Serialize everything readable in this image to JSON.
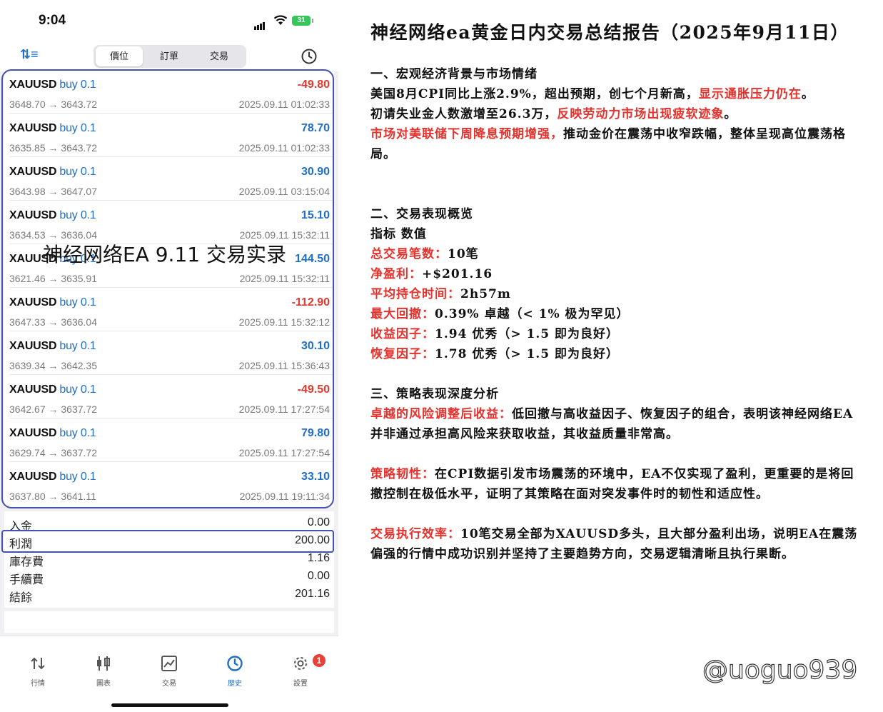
{
  "status_bar": {
    "time": "9:04",
    "battery": "31"
  },
  "tabs": [
    "價位",
    "訂單",
    "交易"
  ],
  "trades": [
    {
      "symbol": "XAUUSD",
      "side": "buy 0.1",
      "prices": "3648.70 → 3643.72",
      "profit": "-49.80",
      "date": "2025.09.11 01:02:33"
    },
    {
      "symbol": "XAUUSD",
      "side": "buy 0.1",
      "prices": "3635.85 → 3643.72",
      "profit": "78.70",
      "date": "2025.09.11 01:02:33"
    },
    {
      "symbol": "XAUUSD",
      "side": "buy 0.1",
      "prices": "3643.98 → 3647.07",
      "profit": "30.90",
      "date": "2025.09.11 03:15:04"
    },
    {
      "symbol": "XAUUSD",
      "side": "buy 0.1",
      "prices": "3634.53 → 3636.04",
      "profit": "15.10",
      "date": "2025.09.11 15:32:11"
    },
    {
      "symbol": "XAUUSD",
      "side": "buy 0.1",
      "prices": "3621.46 → 3635.91",
      "profit": "144.50",
      "date": "2025.09.11 15:32:11"
    },
    {
      "symbol": "XAUUSD",
      "side": "buy 0.1",
      "prices": "3647.33 → 3636.04",
      "profit": "-112.90",
      "date": "2025.09.11 15:32:12"
    },
    {
      "symbol": "XAUUSD",
      "side": "buy 0.1",
      "prices": "3639.34 → 3642.35",
      "profit": "30.10",
      "date": "2025.09.11 15:36:43"
    },
    {
      "symbol": "XAUUSD",
      "side": "buy 0.1",
      "prices": "3642.67 → 3637.72",
      "profit": "-49.50",
      "date": "2025.09.11 17:27:54"
    },
    {
      "symbol": "XAUUSD",
      "side": "buy 0.1",
      "prices": "3629.74 → 3637.72",
      "profit": "79.80",
      "date": "2025.09.11 17:27:54"
    },
    {
      "symbol": "XAUUSD",
      "side": "buy 0.1",
      "prices": "3637.80 → 3641.11",
      "profit": "33.10",
      "date": "2025.09.11 19:11:34"
    }
  ],
  "overlay_text": "神经网络EA 9.11 交易实录",
  "summary": [
    {
      "label": "入金",
      "value": "0.00"
    },
    {
      "label": "利潤",
      "value": "200.00"
    },
    {
      "label": "庫存費",
      "value": "1.16"
    },
    {
      "label": "手續費",
      "value": "0.00"
    },
    {
      "label": "結餘",
      "value": "201.16"
    }
  ],
  "nav": [
    {
      "label": "行情",
      "icon": "quotes-arrows-icon"
    },
    {
      "label": "圖表",
      "icon": "candlestick-chart-icon"
    },
    {
      "label": "交易",
      "icon": "trade-chart-icon"
    },
    {
      "label": "歷史",
      "icon": "history-clock-icon"
    },
    {
      "label": "設置",
      "icon": "settings-gear-icon"
    }
  ],
  "nav_badge": "1",
  "report": {
    "title": "神经网络ea黄金日内交易总结报告（2025年9月11日）",
    "s1_heading": "一、宏观经济背景与市场情绪",
    "s1_p1_a": "美国8月CPI同比上涨2.9%，超出预期，创七个月新高，",
    "s1_p1_b": "显示通胀压力仍在",
    "s1_p1_c": "。",
    "s1_p2_a": "初请失业金人数激增至26.3万，",
    "s1_p2_b": "反映劳动力市场出现疲软迹象",
    "s1_p2_c": "。",
    "s1_p3_a": "市场对美联储下周降息预期增强，",
    "s1_p3_b": "推动金价在震荡中收窄跌幅，整体呈现高位震荡格局。",
    "s2_heading": "二、交易表现概览",
    "s2_header": "指标 数值",
    "metrics": [
      {
        "label": "总交易笔数：",
        "value": "10笔"
      },
      {
        "label": "净盈利：",
        "value": "+$201.16"
      },
      {
        "label": "平均持仓时间：",
        "value": "2h57m"
      },
      {
        "label": "最大回撤：",
        "value": "0.39% 卓越（< 1% 极为罕见）"
      },
      {
        "label": "收益因子：",
        "value": "1.94 优秀（> 1.5 即为良好）"
      },
      {
        "label": "恢复因子：",
        "value": "1.78 优秀（> 1.5 即为良好）"
      }
    ],
    "s3_heading": "三、策略表现深度分析",
    "a1_label": "卓越的风险调整后收益：",
    "a1_text": "低回撤与高收益因子、恢复因子的组合，表明该神经网络EA并非通过承担高风险来获取收益，其收益质量非常高。",
    "a2_label": "策略韧性：",
    "a2_text": "在CPI数据引发市场震荡的环境中，EA不仅实现了盈利，更重要的是将回撤控制在极低水平，证明了其策略在面对突发事件时的韧性和适应性。",
    "a3_label": "交易执行效率：",
    "a3_text": "10笔交易全部为XAUUSD多头，且大部分盈利出场，说明EA在震荡偏强的行情中成功识别并坚持了主要趋势方向，交易逻辑清晰且执行果断。"
  },
  "watermark": "@uoguo939",
  "colors": {
    "accent_blue": "#1f6fc9",
    "loss_red": "#e03a2f",
    "highlight_red": "#e5322d",
    "frame": "#4450b3"
  }
}
